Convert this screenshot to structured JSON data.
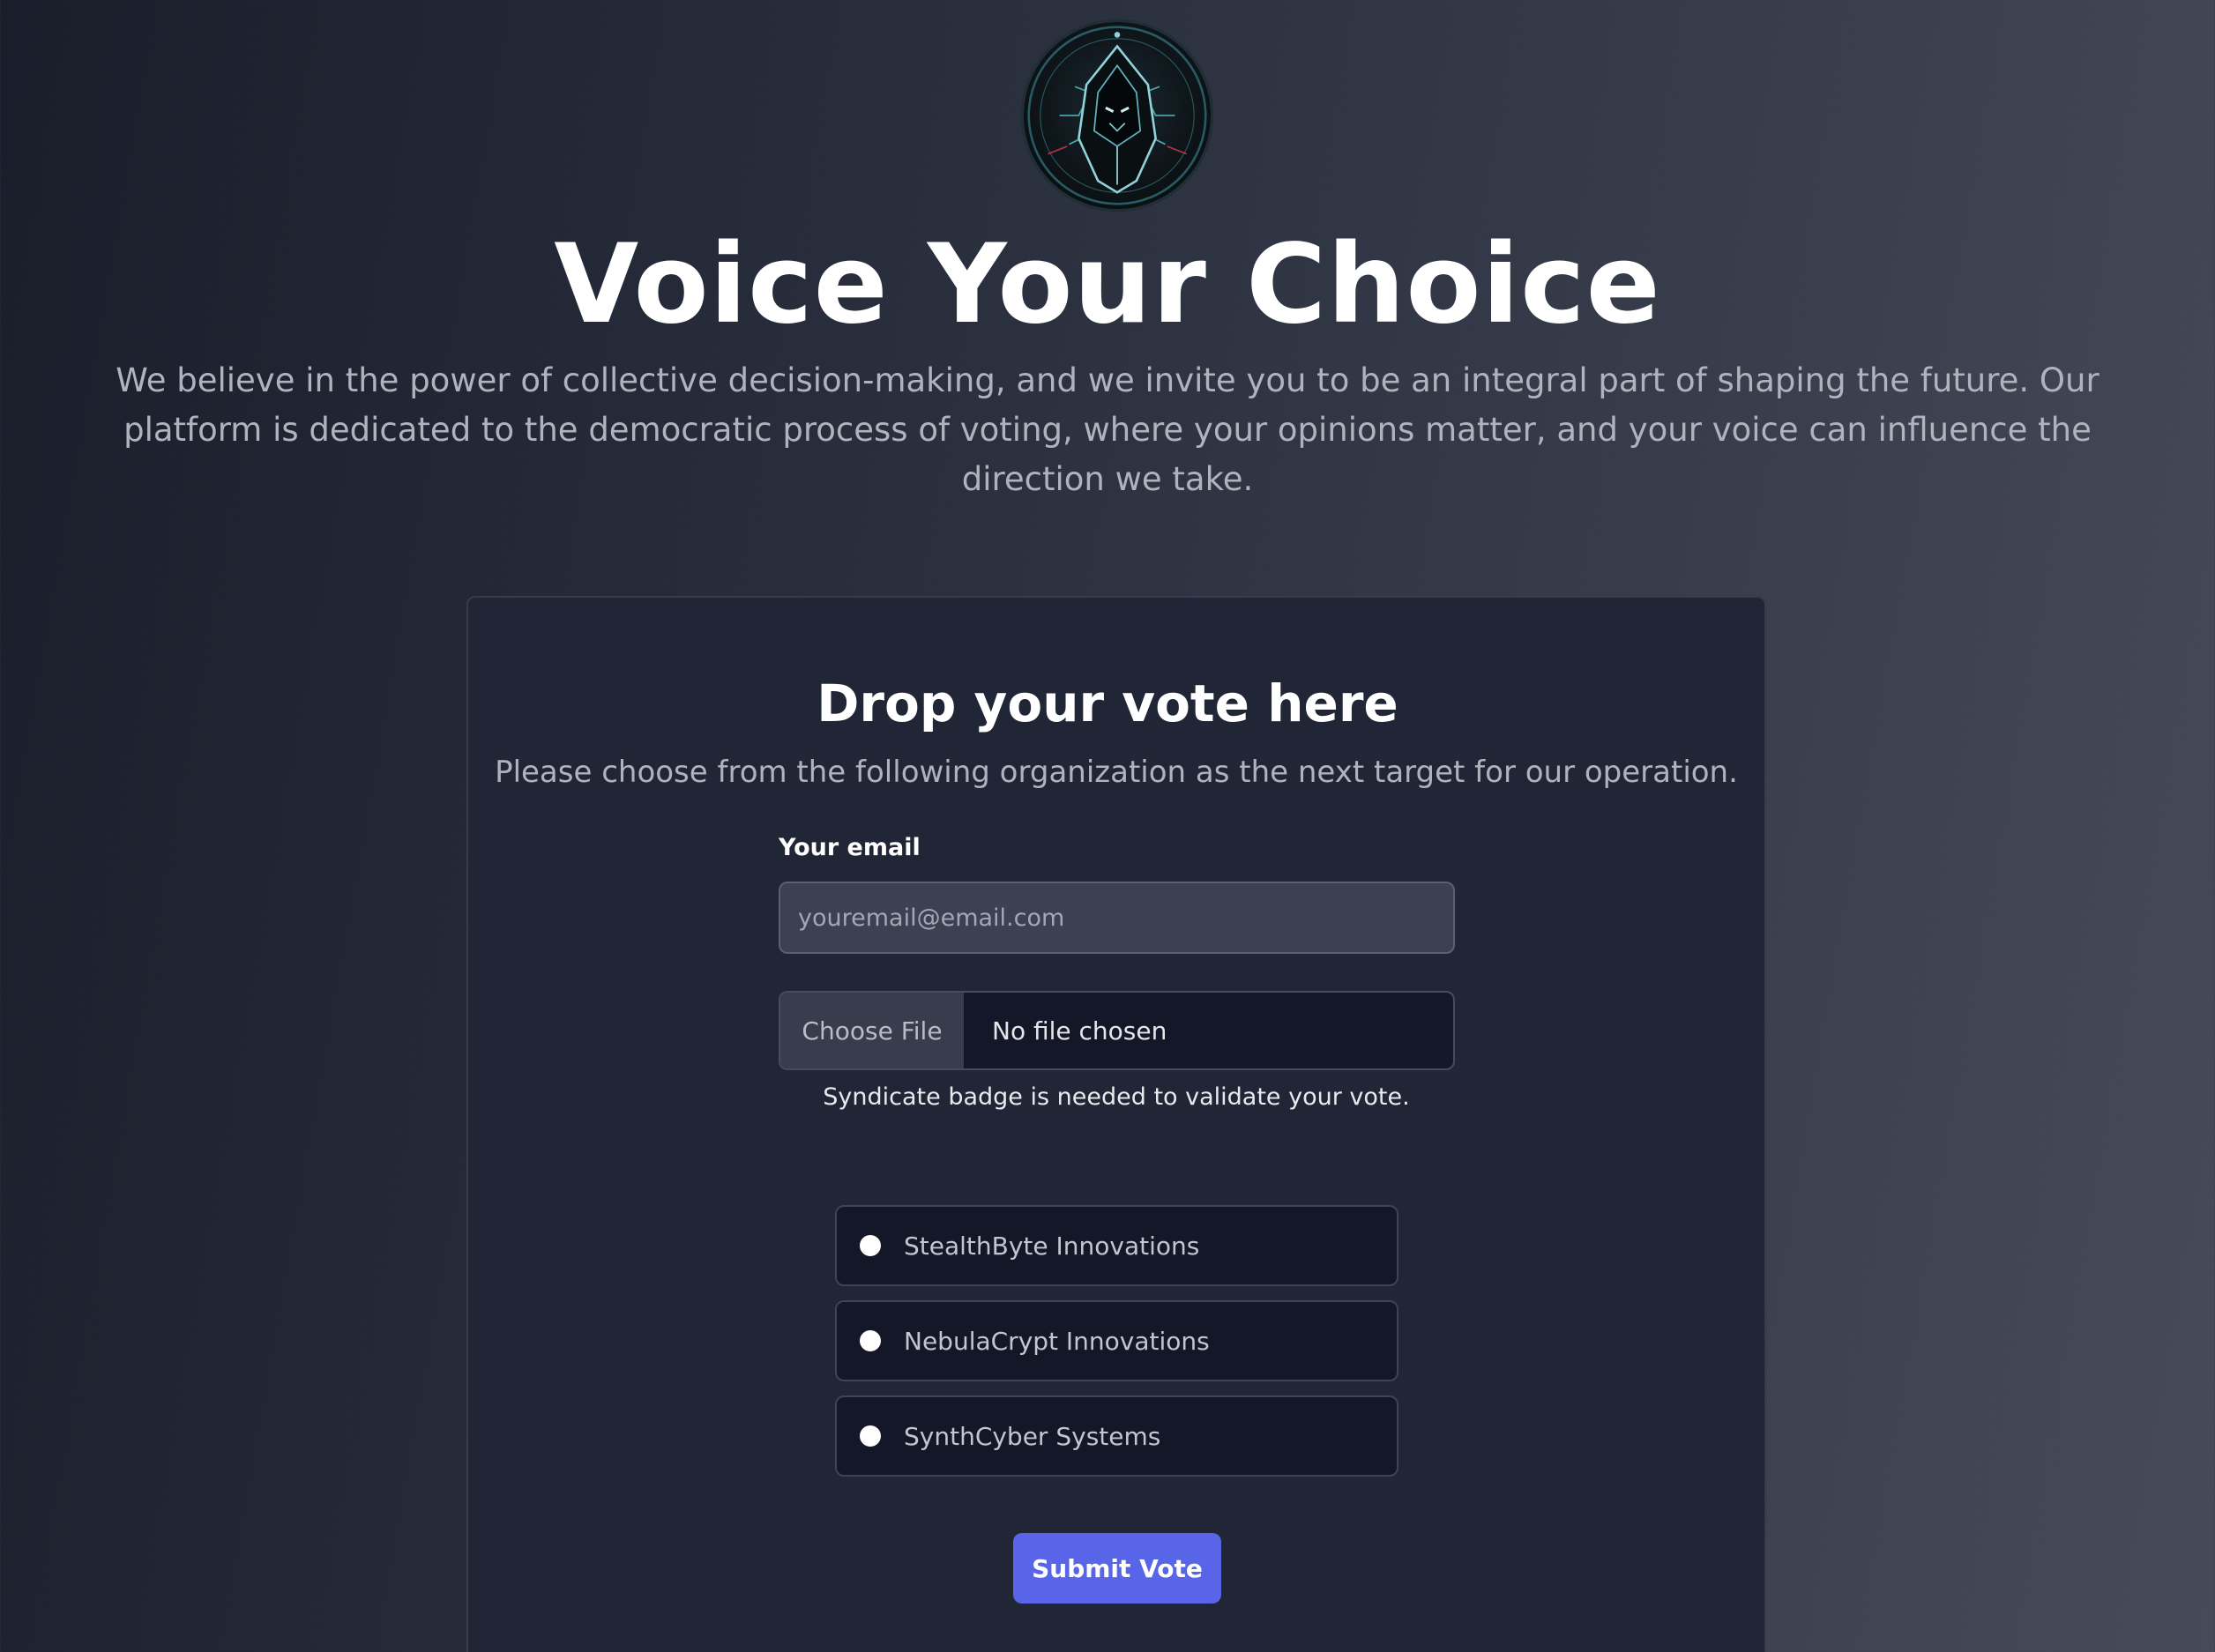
{
  "header": {
    "logo_icon": "hooded-figure-logo-icon",
    "title": "Voice Your Choice",
    "intro": "We believe in the power of collective decision-making, and we invite you to be an integral part of shaping the future. Our platform is dedicated to the democratic process of voting, where your opinions matter, and your voice can influence the direction we take."
  },
  "form": {
    "title": "Drop your vote here",
    "subtitle": "Please choose from the following organization as the next target for our operation.",
    "email_label": "Your email",
    "email_placeholder": "youremail@email.com",
    "email_value": "",
    "file_button_label": "Choose File",
    "file_status": "No file chosen",
    "file_hint": "Syndicate badge is needed to validate your vote.",
    "options": [
      {
        "label": "StealthByte Innovations",
        "selected": false
      },
      {
        "label": "NebulaCrypt Innovations",
        "selected": false
      },
      {
        "label": "SynthCyber Systems",
        "selected": false
      }
    ],
    "submit_label": "Submit Vote",
    "accent_color": "#5865e9"
  }
}
